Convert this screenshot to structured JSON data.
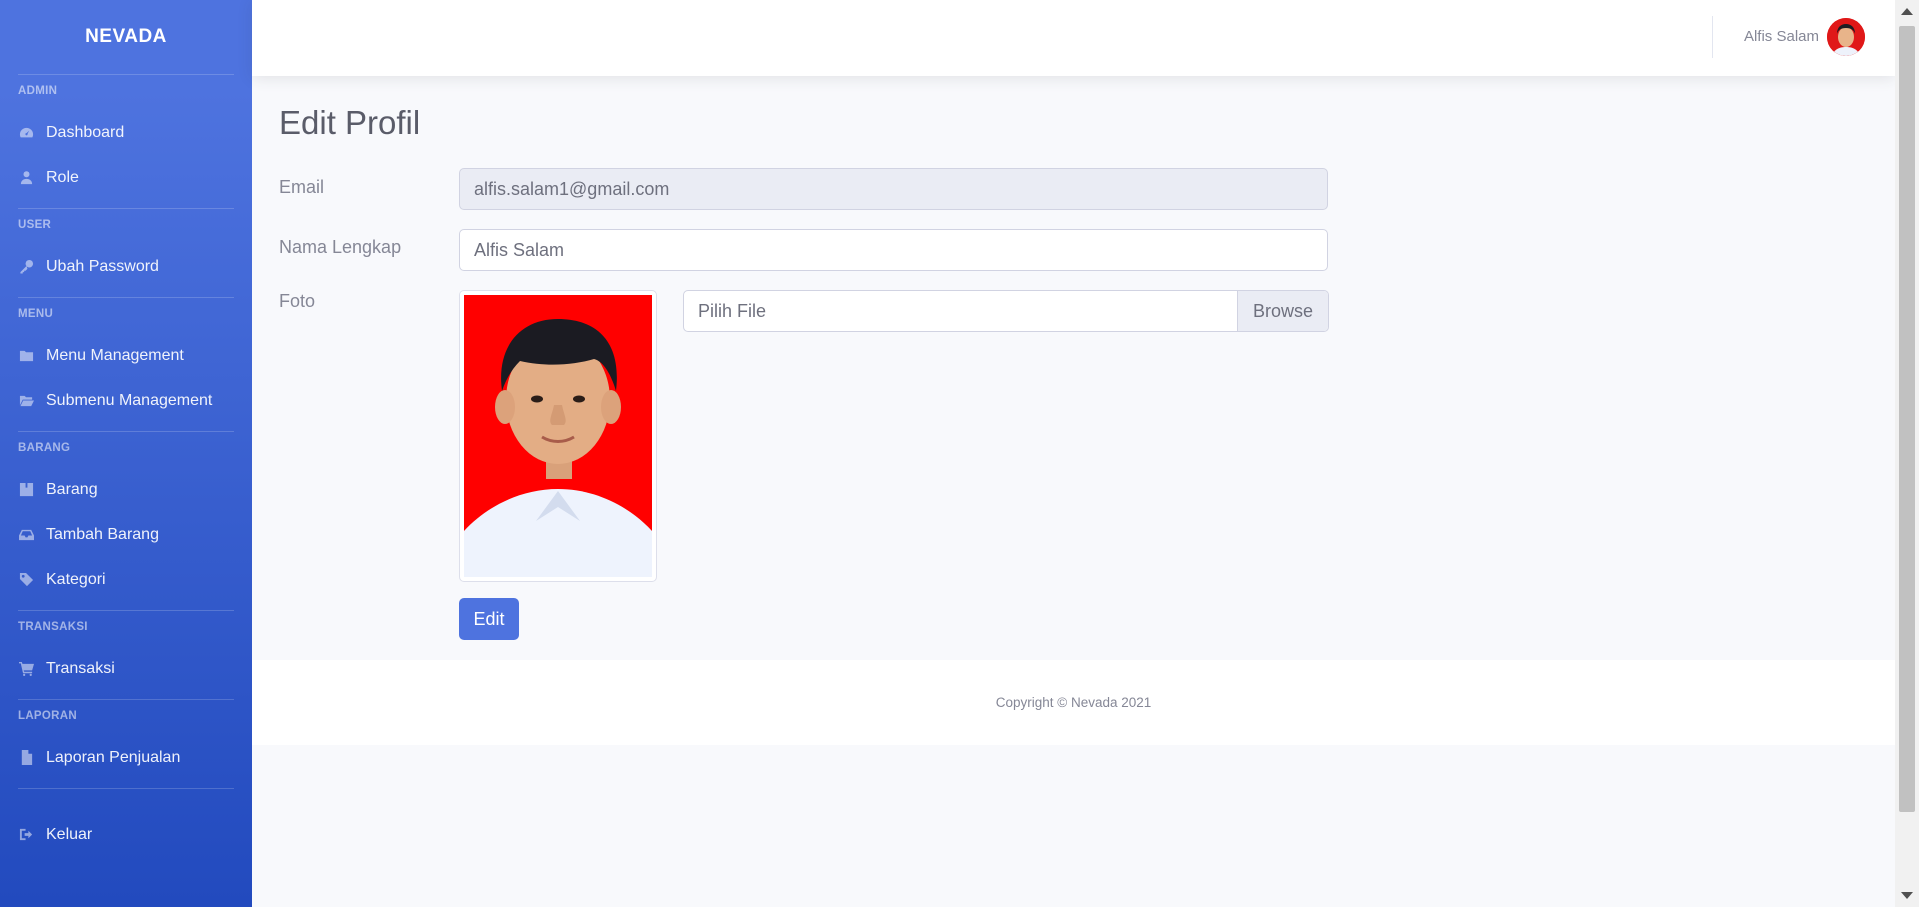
{
  "brand": "NEVADA",
  "sidebar": {
    "sections": {
      "admin": "ADMIN",
      "user": "USER",
      "menu": "MENU",
      "barang": "BARANG",
      "transaksi": "TRANSAKSI",
      "laporan": "LAPORAN"
    },
    "items": {
      "dashboard": {
        "label": "Dashboard",
        "icon": "dashboard-gauge-icon"
      },
      "role": {
        "label": "Role",
        "icon": "user-icon"
      },
      "ubah_password": {
        "label": "Ubah Password",
        "icon": "key-icon"
      },
      "menu_management": {
        "label": "Menu Management",
        "icon": "folder-icon"
      },
      "submenu_management": {
        "label": "Submenu Management",
        "icon": "folder-open-icon"
      },
      "barang": {
        "label": "Barang",
        "icon": "box-icon"
      },
      "tambah_barang": {
        "label": "Tambah Barang",
        "icon": "inbox-icon"
      },
      "kategori": {
        "label": "Kategori",
        "icon": "tags-icon"
      },
      "transaksi": {
        "label": "Transaksi",
        "icon": "cart-icon"
      },
      "laporan_penjualan": {
        "label": "Laporan Penjualan",
        "icon": "file-icon"
      },
      "keluar": {
        "label": "Keluar",
        "icon": "sign-out-icon"
      }
    }
  },
  "topbar": {
    "user_name": "Alfis Salam"
  },
  "page": {
    "title": "Edit Profil",
    "form": {
      "email_label": "Email",
      "email_value": "alfis.salam1@gmail.com",
      "name_label": "Nama Lengkap",
      "name_value": "Alfis Salam",
      "photo_label": "Foto",
      "file_placeholder": "Pilih File",
      "browse_label": "Browse",
      "submit_label": "Edit"
    }
  },
  "footer": {
    "copyright": "Copyright © Nevada 2021"
  },
  "colors": {
    "primary": "#4e73df",
    "sidebar_dark": "#224abe",
    "text_muted": "#858796",
    "photo_background": "#ff0000"
  }
}
